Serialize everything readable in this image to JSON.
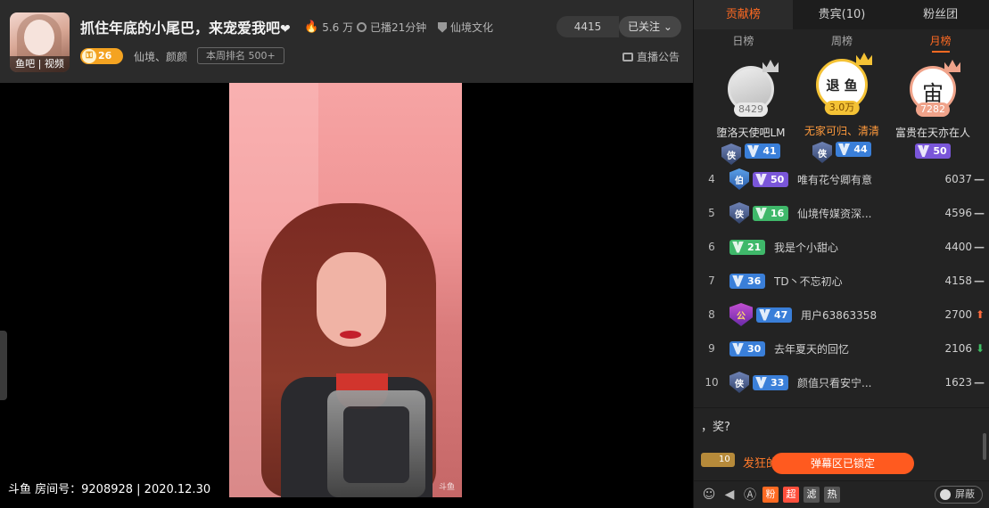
{
  "header": {
    "avatar_label": "鱼吧 | 视频",
    "title": "抓住年底的小尾巴，来宠爱我吧",
    "title_heart": "❤",
    "heat": "5.6 万",
    "live_duration": "已播21分钟",
    "guild": "仙境文化",
    "follower_count": "4415",
    "follow_label": "已关注",
    "level": "26",
    "category": "仙境、颜颜",
    "week_rank": "本周排名 500+",
    "notice_label": "直播公告"
  },
  "video": {
    "room_info": "斗鱼 房间号：9208928 | 2020.12.30",
    "watermark": "斗鱼"
  },
  "panel": {
    "tabs": [
      {
        "label": "贡献榜",
        "active": true
      },
      {
        "label": "贵宾(10)",
        "active": false
      },
      {
        "label": "粉丝团",
        "active": false
      }
    ],
    "subtabs": [
      {
        "label": "日榜",
        "active": false
      },
      {
        "label": "周榜",
        "active": false
      },
      {
        "label": "月榜",
        "active": true
      }
    ],
    "podium": [
      {
        "rank": 2,
        "name": "堕洛天使吧LM",
        "value": "8429",
        "guard": "侠",
        "level": "41",
        "avatar_text": ""
      },
      {
        "rank": 1,
        "name": "无家可归、清清",
        "value": "3.0万",
        "guard": "侠",
        "level": "44",
        "avatar_text": "退 鱼"
      },
      {
        "rank": 3,
        "name": "富贵在天亦在人",
        "value": "7282",
        "guard": "",
        "level": "50",
        "avatar_text": "宙"
      }
    ],
    "ranks": [
      {
        "num": "4",
        "guard": "伯",
        "level": "50",
        "name": "唯有花兮卿有意",
        "score": "6037",
        "trend": "flat"
      },
      {
        "num": "5",
        "guard": "侠",
        "level": "16",
        "name": "仙境传媒资深...",
        "score": "4596",
        "trend": "flat"
      },
      {
        "num": "6",
        "guard": "",
        "level": "21",
        "name": "我是个小甜心",
        "score": "4400",
        "trend": "flat"
      },
      {
        "num": "7",
        "guard": "",
        "level": "36",
        "name": "TD丶不忘初心",
        "score": "4158",
        "trend": "flat"
      },
      {
        "num": "8",
        "guard": "公",
        "level": "47",
        "name": "用户63863358",
        "score": "2700",
        "trend": "up"
      },
      {
        "num": "9",
        "guard": "",
        "level": "30",
        "name": "去年夏天的回忆",
        "score": "2106",
        "trend": "down"
      },
      {
        "num": "10",
        "guard": "侠",
        "level": "33",
        "name": "颜值只看安宁...",
        "score": "1623",
        "trend": "flat"
      }
    ],
    "chat": {
      "message": "，奖?",
      "badge_level": "10",
      "user_fragment": "发狂的",
      "locked_label": "弹幕区已锁定"
    },
    "toolbar": {
      "boxes": [
        {
          "text": "粉",
          "color": "#ff6a22"
        },
        {
          "text": "超",
          "color": "#ff4f3c"
        },
        {
          "text": "滤",
          "color": "#555555"
        },
        {
          "text": "热",
          "color": "#555555"
        }
      ],
      "block_label": "屏蔽"
    }
  },
  "colors": {
    "accent": "#ff6a22",
    "up": "#ff6a3c",
    "down": "#3fbf64"
  }
}
